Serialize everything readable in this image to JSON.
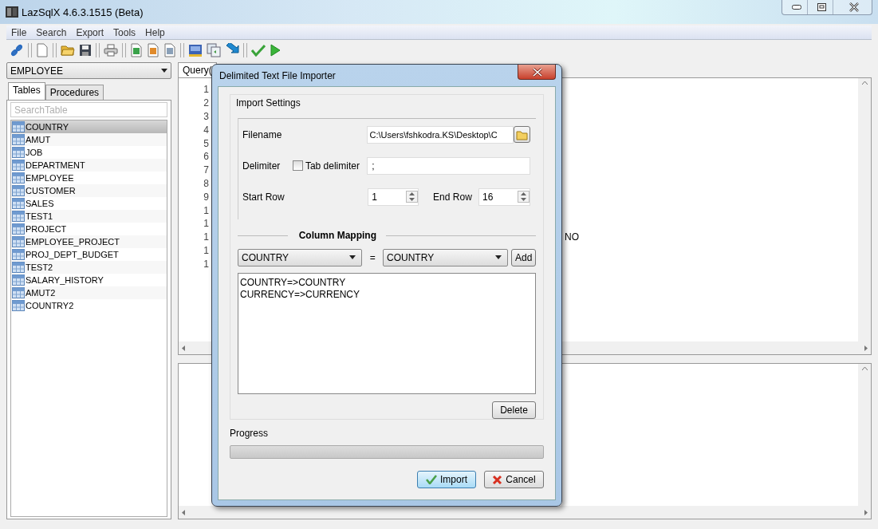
{
  "window": {
    "title": "LazSqlX 4.6.3.1515 (Beta)"
  },
  "menu": [
    "File",
    "Search",
    "Export",
    "Tools",
    "Help"
  ],
  "database_select": {
    "value": "EMPLOYEE"
  },
  "side_tabs": [
    {
      "label": "Tables",
      "selected": true
    },
    {
      "label": "Procedures",
      "selected": false
    }
  ],
  "table_search": {
    "placeholder": "SearchTable"
  },
  "tables": [
    {
      "name": "COUNTRY",
      "selected": true
    },
    {
      "name": "AMUT",
      "selected": false
    },
    {
      "name": "JOB",
      "selected": false
    },
    {
      "name": "DEPARTMENT",
      "selected": false
    },
    {
      "name": "EMPLOYEE",
      "selected": false
    },
    {
      "name": "CUSTOMER",
      "selected": false
    },
    {
      "name": "SALES",
      "selected": false
    },
    {
      "name": "TEST1",
      "selected": false
    },
    {
      "name": "PROJECT",
      "selected": false
    },
    {
      "name": "EMPLOYEE_PROJECT",
      "selected": false
    },
    {
      "name": "PROJ_DEPT_BUDGET",
      "selected": false
    },
    {
      "name": "TEST2",
      "selected": false
    },
    {
      "name": "SALARY_HISTORY",
      "selected": false
    },
    {
      "name": "AMUT2",
      "selected": false
    },
    {
      "name": "COUNTRY2",
      "selected": false
    }
  ],
  "editor": {
    "tabs": [
      {
        "label": "Query(",
        "selected": true
      }
    ],
    "lines": [
      {
        "number": "1"
      },
      {
        "number": "2"
      },
      {
        "number": "3"
      },
      {
        "number": "4"
      },
      {
        "number": "5"
      },
      {
        "number": "6"
      },
      {
        "number": "7"
      },
      {
        "number": "8"
      },
      {
        "number": "9"
      },
      {
        "number": "1"
      },
      {
        "number": "1"
      },
      {
        "number": "1",
        "text": "NO"
      },
      {
        "number": "1"
      },
      {
        "number": "1"
      }
    ]
  },
  "dialog": {
    "title": "Delimited Text File Importer",
    "settings_group": "Import Settings",
    "filename_label": "Filename",
    "filename": "C:\\Users\\fshkodra.KS\\Desktop\\C",
    "delimiter_label": "Delimiter",
    "tab_delimiter": {
      "label": "Tab delimiter",
      "checked": false
    },
    "delimiter": ";",
    "start_row_label": "Start Row",
    "start_row": "1",
    "end_row_label": "End Row",
    "end_row": "16",
    "mapping_title": "Column Mapping",
    "source_column": "COUNTRY",
    "equals": "=",
    "target_column": "COUNTRY",
    "add_button": "Add",
    "mappings": [
      "COUNTRY=>COUNTRY",
      "CURRENCY=>CURRENCY"
    ],
    "delete_button": "Delete",
    "progress_label": "Progress",
    "progress": {
      "level": 0
    },
    "import_button": "Import",
    "cancel_button": "Cancel"
  }
}
